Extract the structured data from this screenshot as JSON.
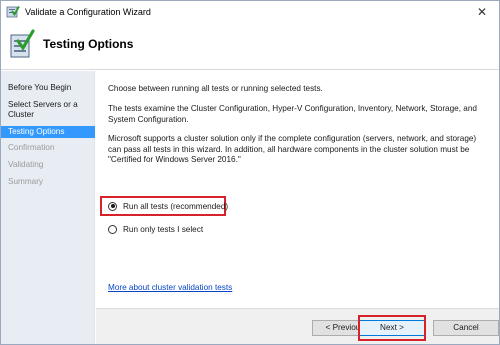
{
  "window": {
    "title": "Validate a Configuration Wizard"
  },
  "header": {
    "title": "Testing Options"
  },
  "sidebar": {
    "steps": [
      {
        "label": "Before You Begin",
        "state": "done"
      },
      {
        "label": "Select Servers or a Cluster",
        "state": "done"
      },
      {
        "label": "Testing Options",
        "state": "active"
      },
      {
        "label": "Confirmation",
        "state": "disabled"
      },
      {
        "label": "Validating",
        "state": "disabled"
      },
      {
        "label": "Summary",
        "state": "disabled"
      }
    ]
  },
  "content": {
    "intro": "Choose between running all tests or running selected tests.",
    "description": "The tests examine the Cluster Configuration, Hyper-V Configuration, Inventory, Network, Storage, and System Configuration.",
    "support_note": "Microsoft supports a cluster solution only if the complete configuration (servers, network, and storage) can pass all tests in this wizard. In addition, all hardware components in the cluster solution must be \"Certified for Windows Server 2016.\"",
    "options": [
      {
        "label": "Run all tests (recommended)",
        "checked": true
      },
      {
        "label": "Run only tests I select",
        "checked": false
      }
    ],
    "link": "More about cluster validation tests"
  },
  "buttons": {
    "previous": "< Previous",
    "next": "Next >",
    "cancel": "Cancel"
  },
  "colors": {
    "active_step": "#3399ff",
    "highlight": "#d6232b",
    "link": "#0645c6"
  },
  "icons": {
    "app": "checklist-icon",
    "header": "checklist-icon",
    "close": "close-icon"
  }
}
